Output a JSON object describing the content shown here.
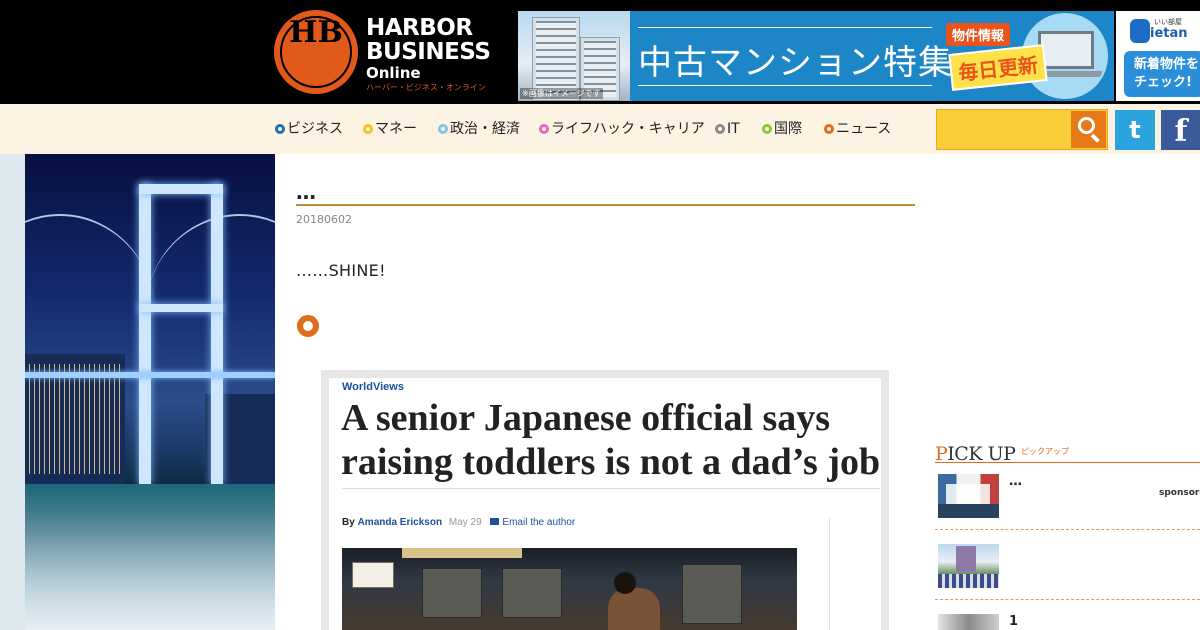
{
  "site": {
    "logo_monogram": "HB",
    "name_line1": "HARBOR",
    "name_line2": "BUSINESS",
    "name_line3": "Online",
    "name_kana": "ハーバー・ビジネス・オンライン"
  },
  "ads": {
    "mansion": {
      "title": "中古マンション特集",
      "tag": "物件情報",
      "daily": "毎日更新",
      "note": "※画像はイメージです"
    },
    "ietan": {
      "small": "いい部屋",
      "brand": "ietan",
      "button_line1": "新着物件を",
      "button_line2": "チェック!"
    }
  },
  "nav": {
    "items": [
      {
        "label": "ビジネス",
        "color": "#1f6fb5"
      },
      {
        "label": "マネー",
        "color": "#f2c418"
      },
      {
        "label": "政治・経済",
        "color": "#7fc3e6"
      },
      {
        "label": "ライフハック・キャリア",
        "color": "#e06cc0"
      },
      {
        "label": "IT",
        "color": "#8a8a8a"
      },
      {
        "label": "国際",
        "color": "#8cc63e"
      },
      {
        "label": "ニュース",
        "color": "#e06c1b"
      }
    ],
    "search_placeholder": "",
    "twitter_glyph": "t",
    "facebook_glyph": "f"
  },
  "article": {
    "title": "…",
    "date": "20180602",
    "lead": "……SHINE!"
  },
  "screenshot": {
    "kicker": "WorldViews",
    "headline_line1": "A senior Japanese official says",
    "headline_line2": "raising toddlers is not a dad’s job",
    "by": "By",
    "author": "Amanda Erickson",
    "date": "May 29",
    "email": "Email the author"
  },
  "sidebar": {
    "pickup_title_first": "P",
    "pickup_title_rest": "ICK UP",
    "pickup_sub": "ピックアップ",
    "items": [
      {
        "text": "…",
        "sponsor": "sponsored"
      },
      {
        "text": "",
        "sponsor": ""
      },
      {
        "text": "1",
        "sponsor": ""
      }
    ]
  },
  "colors": {
    "brand_orange": "#e15a19",
    "nav_bg": "#fdf3e2",
    "search_yellow": "#f9cc38",
    "twitter": "#2aa3de",
    "facebook": "#3b5a9a"
  }
}
